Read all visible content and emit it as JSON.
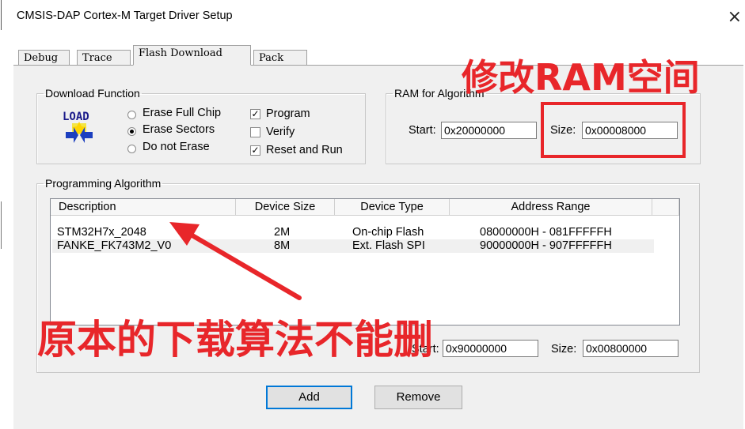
{
  "window": {
    "title": "CMSIS-DAP Cortex-M Target Driver Setup",
    "close_glyph": "×"
  },
  "tabs": [
    "Debug",
    "Trace",
    "Flash Download",
    "Pack"
  ],
  "download_function": {
    "legend": "Download Function",
    "load_icon_text": "LOAD",
    "options": [
      "Erase Full Chip",
      "Erase Sectors",
      "Do not Erase"
    ],
    "selected_option": "Erase Sectors",
    "checks": [
      {
        "label": "Program",
        "checked": true
      },
      {
        "label": "Verify",
        "checked": false
      },
      {
        "label": "Reset and Run",
        "checked": true
      }
    ]
  },
  "ram": {
    "legend": "RAM for Algorithm",
    "start_label": "Start:",
    "start_value": "0x20000000",
    "size_label": "Size:",
    "size_value": "0x00008000"
  },
  "algorithm": {
    "legend": "Programming Algorithm",
    "columns": [
      "Description",
      "Device Size",
      "Device Type",
      "Address Range"
    ],
    "rows": [
      {
        "description": "STM32H7x_2048",
        "size": "2M",
        "type": "On-chip Flash",
        "range": "08000000H - 081FFFFFH"
      },
      {
        "description": "FANKE_FK743M2_V0",
        "size": "8M",
        "type": "Ext. Flash SPI",
        "range": "90000000H - 907FFFFFH"
      }
    ],
    "start_label": "Start:",
    "start_value": "0x90000000",
    "size_label": "Size:",
    "size_value": "0x00800000"
  },
  "buttons": {
    "add": "Add",
    "remove": "Remove"
  },
  "annotations": {
    "top_right": "修改RAM空间",
    "bottom": "原本的下载算法不能删",
    "color": "#e8262a"
  }
}
